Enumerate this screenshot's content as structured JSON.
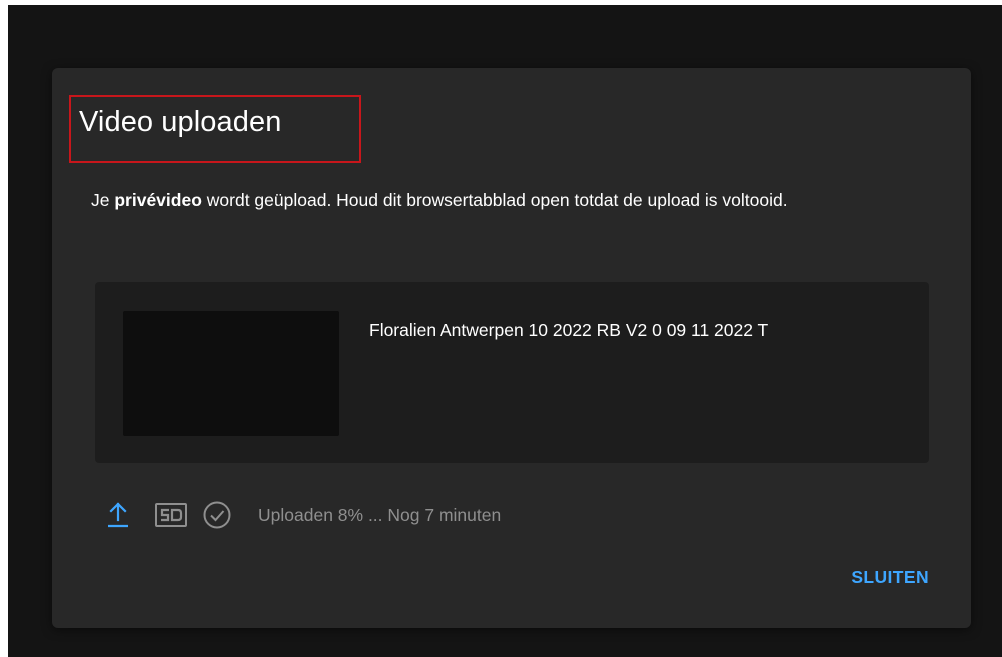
{
  "dialog": {
    "title": "Video uploaden",
    "message": {
      "prefix": "Je ",
      "emphasis": "privévideo",
      "suffix": " wordt geüpload. Houd dit browsertabblad open totdat de upload is voltooid."
    },
    "file": {
      "name": "Floralien Antwerpen 10 2022 RB V2 0 09 11 2022 T"
    },
    "status": {
      "icons": [
        "upload-arrow-icon",
        "sd-quality-icon",
        "check-circle-icon"
      ],
      "text": "Uploaden 8% ... Nog 7 minuten",
      "progress_percent": 8
    },
    "close_label": "SLUITEN"
  },
  "colors": {
    "backdrop": "#141414",
    "dialog": "#282828",
    "card": "#1d1d1d",
    "accent": "#3ea6ff",
    "highlight_box": "#c8161b",
    "muted_text": "#8f8f8f"
  }
}
